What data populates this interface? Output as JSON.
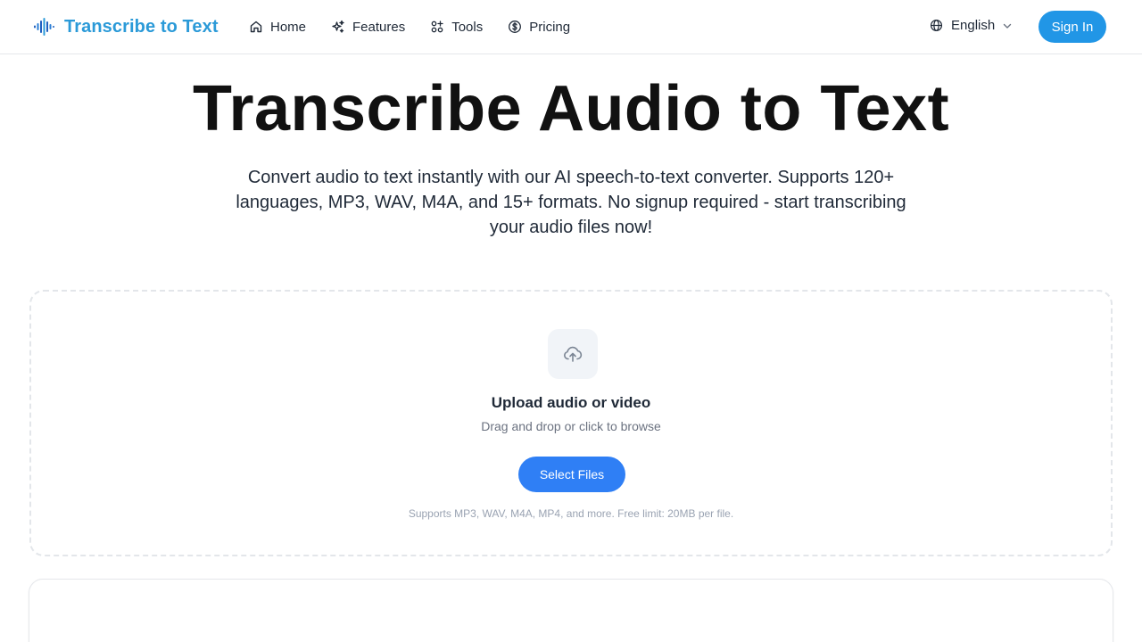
{
  "brand": {
    "name": "Transcribe to Text",
    "color": "#2b9ad8",
    "icon": "sound-wave-icon"
  },
  "nav": {
    "links": [
      {
        "label": "Home",
        "icon": "home-icon"
      },
      {
        "label": "Features",
        "icon": "sparkles-icon"
      },
      {
        "label": "Tools",
        "icon": "tools-icon"
      },
      {
        "label": "Pricing",
        "icon": "dollar-circle-icon"
      }
    ],
    "language": {
      "label": "English",
      "icon": "globe-icon"
    },
    "signin_label": "Sign In"
  },
  "hero": {
    "title": "Transcribe Audio to Text",
    "subtitle": "Convert audio to text instantly with our AI speech-to-text converter. Supports 120+ languages, MP3, WAV, M4A, and 15+ formats. No signup required - start transcribing your audio files now!"
  },
  "upload": {
    "icon": "cloud-upload-icon",
    "title": "Upload audio or video",
    "hint": "Drag and drop or click to browse",
    "button_label": "Select Files",
    "note": "Supports MP3, WAV, M4A, MP4, and more. Free limit: 20MB per file."
  },
  "colors": {
    "accent": "#2196e6",
    "primary_button": "#2f7ff5"
  }
}
